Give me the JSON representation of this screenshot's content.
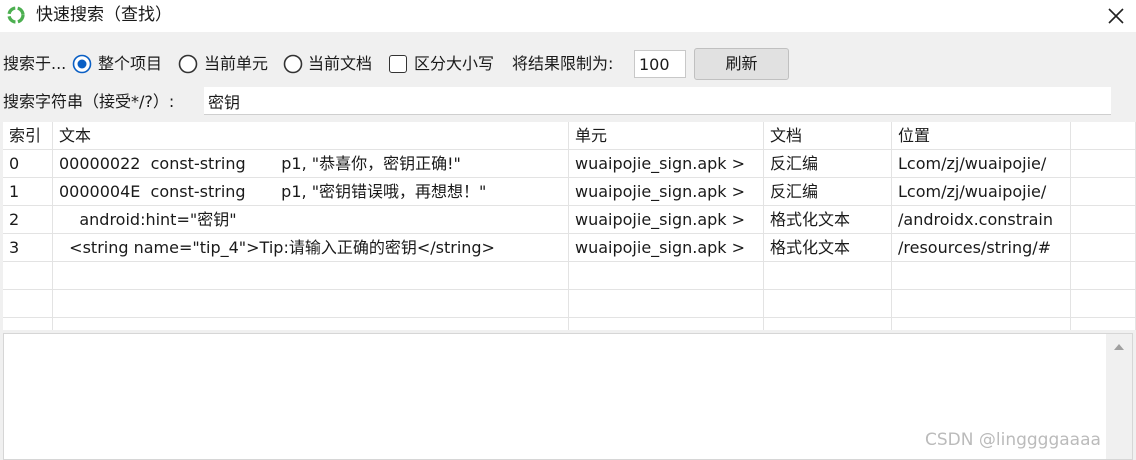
{
  "window": {
    "title": "快速搜索（查找）"
  },
  "options": {
    "search_in_label": "搜索于...",
    "scope_radios": [
      {
        "label": "整个项目",
        "selected": true
      },
      {
        "label": "当前单元",
        "selected": false
      },
      {
        "label": "当前文档",
        "selected": false
      }
    ],
    "case_sensitive": {
      "label": "区分大小写",
      "checked": false
    },
    "limit_label": "将结果限制为:",
    "limit_value": "100",
    "refresh_label": "刷新"
  },
  "search": {
    "label": "搜索字符串（接受*/?）:",
    "value": "密钥"
  },
  "table": {
    "columns": [
      "索引",
      "文本",
      "单元",
      "文档",
      "位置"
    ],
    "rows": [
      {
        "index": "0",
        "text": "00000022  const-string       p1, \"恭喜你，密钥正确!\"",
        "unit": "wuaipojie_sign.apk >",
        "document": "反汇编",
        "location": "Lcom/zj/wuaipojie/"
      },
      {
        "index": "1",
        "text": "0000004E  const-string       p1, \"密钥错误哦，再想想！\"",
        "unit": "wuaipojie_sign.apk >",
        "document": "反汇编",
        "location": "Lcom/zj/wuaipojie/"
      },
      {
        "index": "2",
        "text": "    android:hint=\"密钥\"",
        "unit": "wuaipojie_sign.apk >",
        "document": "格式化文本",
        "location": "/androidx.constrain"
      },
      {
        "index": "3",
        "text": "  <string name=\"tip_4\">Tip:请输入正确的密钥</string>",
        "unit": "wuaipojie_sign.apk >",
        "document": "格式化文本",
        "location": "/resources/string/#"
      }
    ]
  },
  "watermark": "CSDN @linggggaaaa",
  "colors": {
    "accent": "#0a5fc4",
    "app_icon": "#4caf50"
  }
}
